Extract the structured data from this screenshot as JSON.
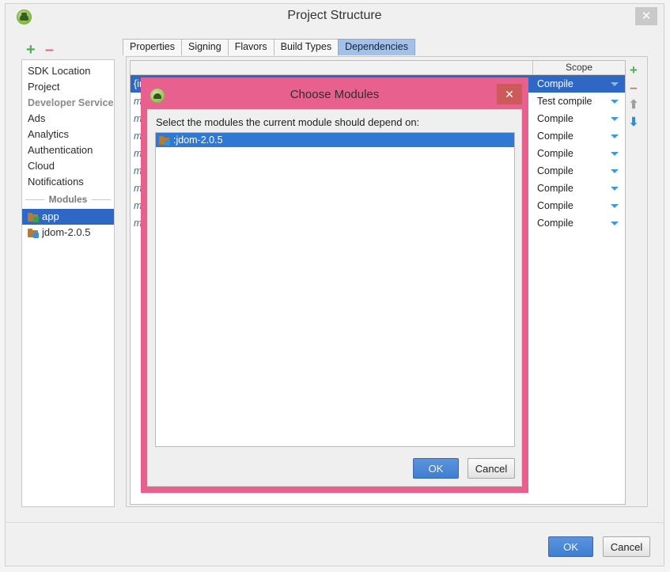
{
  "window": {
    "title": "Project Structure",
    "app_icon": "android-studio-icon",
    "close_label": "✕"
  },
  "toolbar": {
    "add_label": "+",
    "remove_label": "–"
  },
  "sidebar": {
    "items": [
      {
        "label": "SDK Location",
        "type": "item"
      },
      {
        "label": "Project",
        "type": "item"
      },
      {
        "label": "Developer Services",
        "type": "group"
      },
      {
        "label": "Ads",
        "type": "item"
      },
      {
        "label": "Analytics",
        "type": "item"
      },
      {
        "label": "Authentication",
        "type": "item"
      },
      {
        "label": "Cloud",
        "type": "item"
      },
      {
        "label": "Notifications",
        "type": "item"
      }
    ],
    "modules_separator": "Modules",
    "modules": [
      {
        "label": "app",
        "selected": true,
        "icon": "module-folder-icon"
      },
      {
        "label": "jdom-2.0.5",
        "selected": false,
        "icon": "library-folder-icon"
      }
    ]
  },
  "tabs": [
    {
      "label": "Properties",
      "active": false
    },
    {
      "label": "Signing",
      "active": false
    },
    {
      "label": "Flavors",
      "active": false
    },
    {
      "label": "Build Types",
      "active": false
    },
    {
      "label": "Dependencies",
      "active": true
    }
  ],
  "dependencies": {
    "columns": {
      "scope_header": "Scope"
    },
    "rows": [
      {
        "name": "{include=[*.jar], dir=libs}",
        "scope": "Compile",
        "selected": true
      },
      {
        "name": "m",
        "scope": "Test compile",
        "selected": false
      },
      {
        "name": "m",
        "scope": "Compile",
        "selected": false
      },
      {
        "name": "m",
        "scope": "Compile",
        "selected": false
      },
      {
        "name": "m",
        "scope": "Compile",
        "selected": false
      },
      {
        "name": "m",
        "scope": "Compile",
        "selected": false
      },
      {
        "name": "m",
        "scope": "Compile",
        "selected": false
      },
      {
        "name": "m",
        "scope": "Compile",
        "selected": false
      },
      {
        "name": "m",
        "scope": "Compile",
        "selected": false
      }
    ],
    "side_tools": [
      {
        "name": "add",
        "glyph": "+"
      },
      {
        "name": "remove",
        "glyph": "–"
      },
      {
        "name": "move-up",
        "glyph": "⬆"
      },
      {
        "name": "move-down",
        "glyph": "⬇"
      }
    ]
  },
  "footer": {
    "ok_label": "OK",
    "cancel_label": "Cancel"
  },
  "dialog": {
    "title": "Choose Modules",
    "icon": "android-studio-icon",
    "close_label": "✕",
    "prompt": "Select the modules the current module should depend on:",
    "modules": [
      {
        "label": ":jdom-2.0.5",
        "selected": true,
        "icon": "library-folder-icon"
      }
    ],
    "ok_label": "OK",
    "cancel_label": "Cancel",
    "border_color": "#e8608e"
  }
}
